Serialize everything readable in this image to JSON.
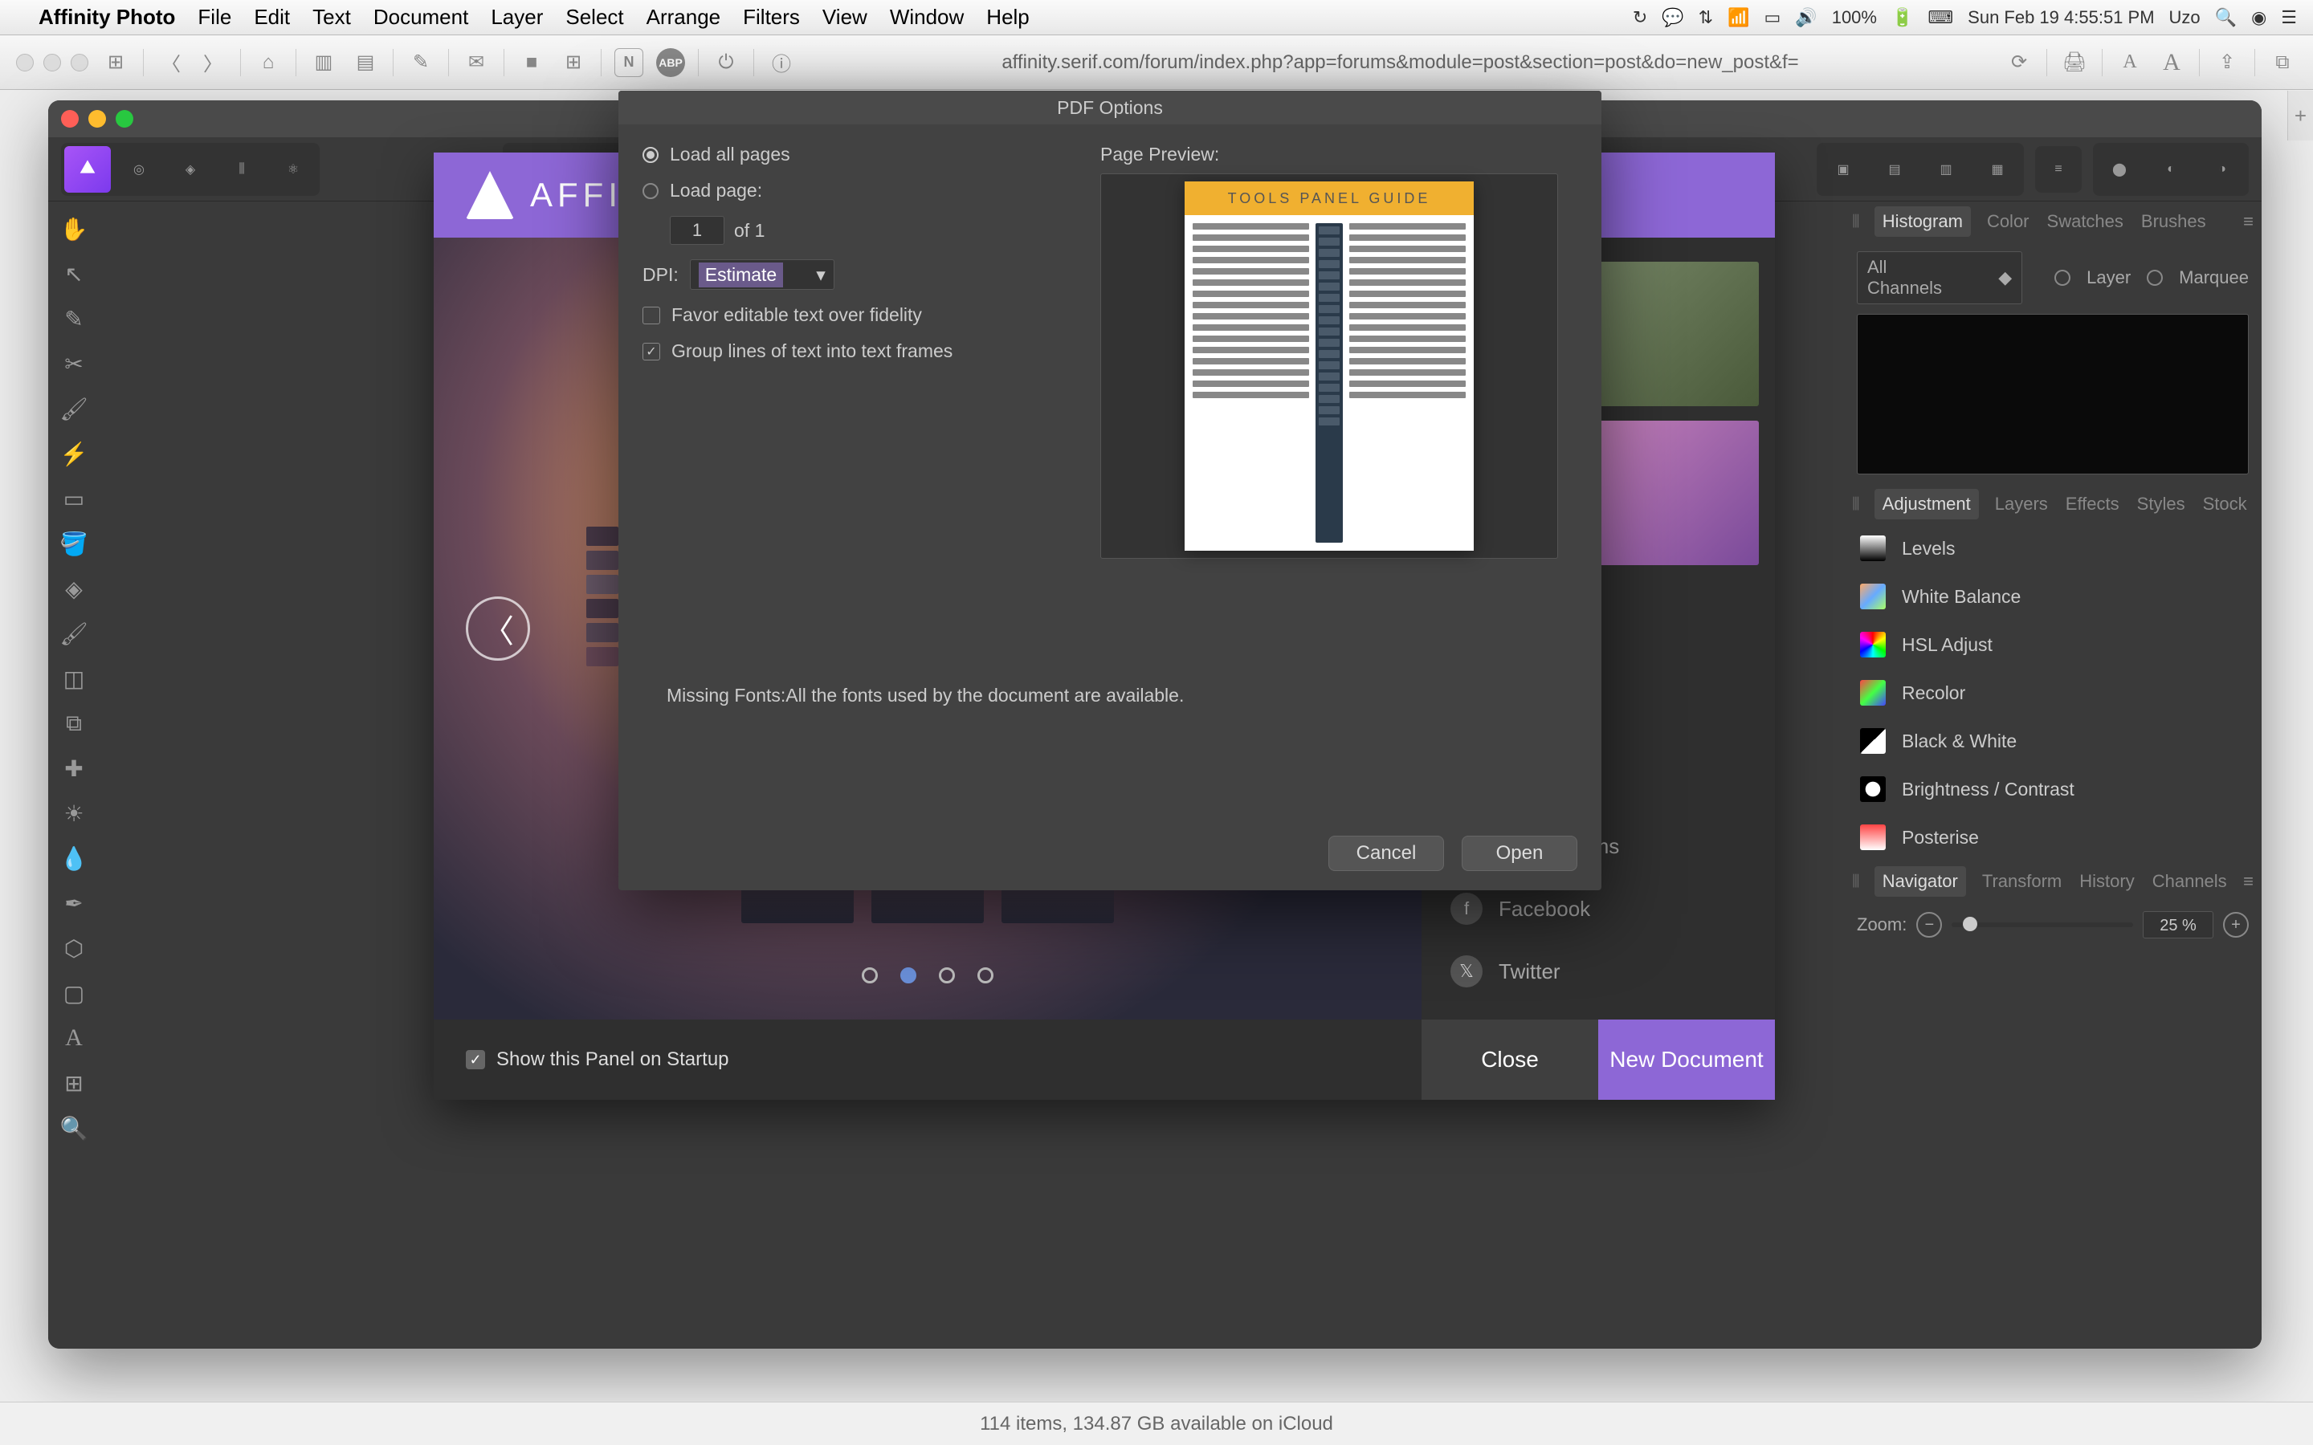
{
  "menubar": {
    "app": "Affinity Photo",
    "items": [
      "File",
      "Edit",
      "Text",
      "Document",
      "Layer",
      "Select",
      "Arrange",
      "Filters",
      "View",
      "Window",
      "Help"
    ],
    "battery": "100%",
    "clock": "Sun Feb 19  4:55:51 PM",
    "user": "Uzo"
  },
  "browser": {
    "url": "affinity.serif.com/forum/index.php?app=forums&module=post&section=post&do=new_post&f="
  },
  "app": {
    "title": "Affinity Photo"
  },
  "tools_left": [
    "hand",
    "move",
    "eyedrop",
    "crop",
    "brush",
    "clone",
    "marquee",
    "fill",
    "healing",
    "pen",
    "pencil",
    "erase",
    "zoom",
    "shape",
    "blur",
    "smudge",
    "dodge",
    "gradient",
    "text",
    "mesh",
    "magnify"
  ],
  "welcome": {
    "brand": "AFFINITY",
    "show_on_startup": "Show this Panel on Startup",
    "close": "Close",
    "new_doc": "New Document",
    "links": {
      "forums": "User Forums",
      "facebook": "Facebook",
      "twitter": "Twitter"
    }
  },
  "pdf": {
    "title": "PDF Options",
    "load_all": "Load all pages",
    "load_page": "Load page:",
    "page_num": "1",
    "of": "of 1",
    "dpi_label": "DPI:",
    "dpi_value": "Estimate",
    "favor": "Favor editable text over fidelity",
    "group": "Group lines of text into text frames",
    "preview_label": "Page Preview:",
    "preview_title": "TOOLS PANEL GUIDE",
    "missing_prefix": "Missing Fonts:",
    "missing_msg": "All the fonts used by the document are available.",
    "cancel": "Cancel",
    "open": "Open"
  },
  "panels": {
    "hist_tabs": [
      "Histogram",
      "Color",
      "Swatches",
      "Brushes"
    ],
    "hist_channels": "All Channels",
    "hist_layer": "Layer",
    "hist_marquee": "Marquee",
    "adj_tabs": [
      "Adjustment",
      "Layers",
      "Effects",
      "Styles",
      "Stock"
    ],
    "adjustments": [
      {
        "name": "Levels",
        "color": "linear-gradient(#fff,#000)"
      },
      {
        "name": "White Balance",
        "color": "linear-gradient(135deg,#f66,#6af,#fa6)"
      },
      {
        "name": "HSL Adjust",
        "color": "conic-gradient(#f00,#ff0,#0f0,#0ff,#00f,#f0f,#f00)"
      },
      {
        "name": "Recolor",
        "color": "linear-gradient(135deg,#f44,#4f4,#44f)"
      },
      {
        "name": "Black & White",
        "color": "linear-gradient(135deg,#000 50%,#fff 50%)"
      },
      {
        "name": "Brightness / Contrast",
        "color": "radial-gradient(circle,#fff 40%,#000 42%)"
      },
      {
        "name": "Posterise",
        "color": "linear-gradient(#f44,#fff)"
      }
    ],
    "nav_tabs": [
      "Navigator",
      "Transform",
      "History",
      "Channels"
    ],
    "zoom_label": "Zoom:",
    "zoom_value": "25 %"
  },
  "finder_status": "114 items, 134.87 GB available on iCloud"
}
